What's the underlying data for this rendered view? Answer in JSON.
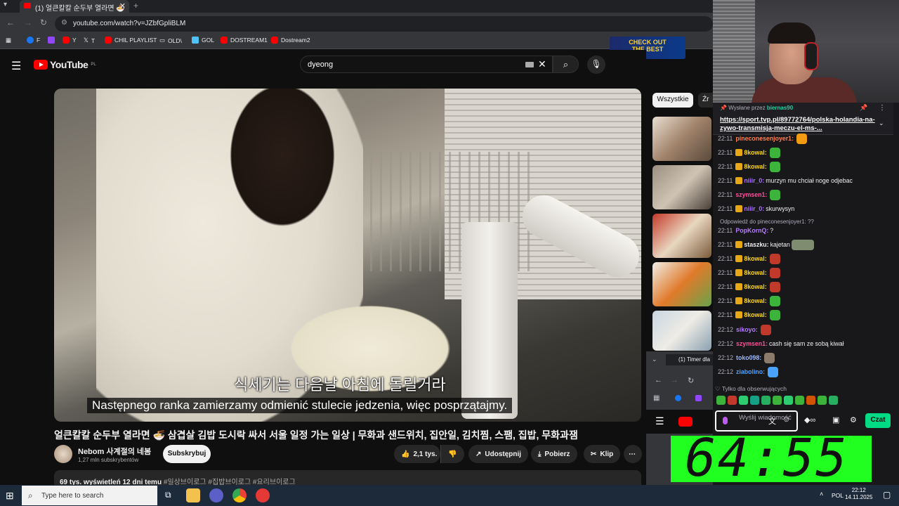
{
  "browser": {
    "tab_title": "(1) 얼큰칼칼 순두부 열라면 🍜",
    "new_tab": "+",
    "url": "youtube.com/watch?v=JZbfGpliBLM",
    "bookmarks": [
      {
        "label": "F",
        "color": "#1877f2"
      },
      {
        "label": "",
        "color": "#9146ff"
      },
      {
        "label": "Y",
        "color": "#ff0000"
      },
      {
        "label": "T",
        "color": "#000000"
      },
      {
        "label": "CHIL PLAYLIST",
        "color": "#ff0000"
      },
      {
        "label": "OLD\\",
        "color": "#bdc1c6"
      },
      {
        "label": "GOL",
        "color": "#4fc3f7"
      },
      {
        "label": "DOSTREAM1",
        "color": "#ff0000"
      },
      {
        "label": "Dostream2",
        "color": "#ff0000"
      }
    ]
  },
  "promo": {
    "line1": "CHECK OUT",
    "line2": "THE BEST"
  },
  "youtube": {
    "logo": "YouTube",
    "region": "PL",
    "search_value": "dyeong",
    "subtitle_korean": "식세기는 다음날 아침에 돌릴거라",
    "subtitle_polish": "Następnego ranka zamierzamy odmienić stulecie jedzenia, więc posprzątajmy.",
    "video_title": "얼큰칼칼 순두부 열라면 🍜 삼겹살 김밥 도시락 싸서 서울 일정 가는 일상 | 무화과 샌드위치, 집안일, 김치찜, 스팸, 집밥, 무화과잼",
    "channel_name": "Nebom 사계절의 네봄",
    "channel_subs": "1,27 mln subskrybentów",
    "subscribe": "Subskrybuj",
    "likes": "2,1 tys.",
    "share": "Udostępnij",
    "download": "Pobierz",
    "clip": "Klip",
    "views_date": "69 tys. wyświetleń  12 dni temu",
    "hashtags": "#일상브이로그 #집밥브이로그 #요리브이로그",
    "chip_all": "Wszystkie",
    "chip_2": "Źr"
  },
  "mini_browser": {
    "tab": "(1) Timer dla"
  },
  "chat": {
    "pinned_by": "Wysłane przez",
    "pinned_user": "biernas90",
    "pinned_link": "https://sport.tvp.pl/89772764/polska-holandia-na-zywo-transmisja-meczu-el-ms-...",
    "reply_hint": "Odpowiedź do pineconesenjoyer1: ??",
    "messages": [
      {
        "time": "22:11",
        "user": "pineconesenjoyer1:",
        "color": "#ff7f50",
        "text": ""
      },
      {
        "time": "22:11",
        "user": "8kowal:",
        "color": "#ffd700",
        "text": ""
      },
      {
        "time": "22:11",
        "user": "8kowal:",
        "color": "#ffd700",
        "text": ""
      },
      {
        "time": "22:11",
        "user": "niiir_0:",
        "color": "#a970ff",
        "text": "murzyn mu chciał noge odjebac"
      },
      {
        "time": "22:11",
        "user": "szymsen1:",
        "color": "#ff4f9a",
        "text": ""
      },
      {
        "time": "22:11",
        "user": "niiir_0:",
        "color": "#a970ff",
        "text": "skurwysyn"
      },
      {
        "time": "22:11",
        "user": "PopKornQ:",
        "color": "#b57bff",
        "text": "?"
      },
      {
        "time": "22:11",
        "user": "staszku:",
        "color": "#efeff1",
        "text": "kajetan"
      },
      {
        "time": "22:11",
        "user": "8kowal:",
        "color": "#ffd700",
        "text": ""
      },
      {
        "time": "22:11",
        "user": "8kowal:",
        "color": "#ffd700",
        "text": ""
      },
      {
        "time": "22:11",
        "user": "8kowal:",
        "color": "#ffd700",
        "text": ""
      },
      {
        "time": "22:11",
        "user": "8kowal:",
        "color": "#ffd700",
        "text": ""
      },
      {
        "time": "22:11",
        "user": "8kowal:",
        "color": "#ffd700",
        "text": ""
      },
      {
        "time": "22:12",
        "user": "sikoyo:",
        "color": "#b57bff",
        "text": ""
      },
      {
        "time": "22:12",
        "user": "szymsen1:",
        "color": "#ff4f9a",
        "text": "cash się sam ze sobą kiwał"
      },
      {
        "time": "22:12",
        "user": "toko098:",
        "color": "#9ab8ff",
        "text": ""
      },
      {
        "time": "22:12",
        "user": "ziabolino:",
        "color": "#4aa3ff",
        "text": ""
      }
    ],
    "followers_only": "Tylko dla obserwujących",
    "input_placeholder": "Wyślij wiadomość",
    "send": "Czat"
  },
  "timer": {
    "value": "64:55"
  },
  "taskbar": {
    "search_placeholder": "Type here to search",
    "lang": "POL",
    "time": "22:12",
    "date": "14.11.2025"
  }
}
